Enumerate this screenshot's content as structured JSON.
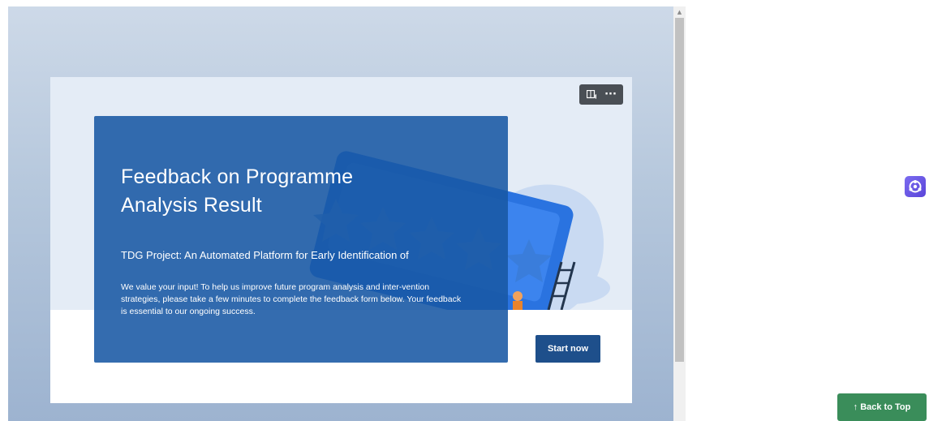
{
  "form": {
    "title": "Feedback on Programme Analysis Result",
    "subtitle": "TDG Project: An Automated Platform for Early Identification of",
    "description": "We value your input! To help us improve future program analysis and inter-vention strategies, please take a few minutes to complete the feedback form below. Your feedback is essential to our ongoing success.",
    "start_label": "Start now"
  },
  "toolbar": {
    "immersive_icon": "immersive-reader-icon",
    "more_label": "···"
  },
  "page": {
    "back_to_top_label": "↑ Back to Top",
    "side_widget_icon": "assistant-icon",
    "scroll_up_glyph": "▲"
  },
  "colors": {
    "overlay": "#1858a4",
    "start_button": "#1e4f8b",
    "back_to_top": "#3a8d5a",
    "hero_bg": "#e4ecf6"
  }
}
